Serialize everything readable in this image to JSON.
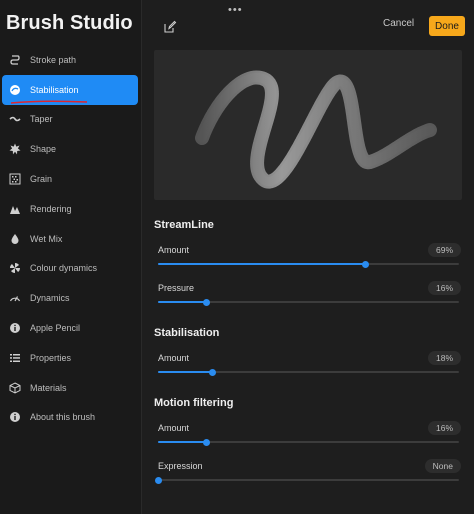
{
  "app_title": "Brush Studio",
  "sidebar": {
    "items": [
      {
        "label": "Stroke path",
        "icon": "stroke-path-icon"
      },
      {
        "label": "Stabilisation",
        "icon": "stabilisation-icon",
        "active": true
      },
      {
        "label": "Taper",
        "icon": "taper-icon"
      },
      {
        "label": "Shape",
        "icon": "shape-icon"
      },
      {
        "label": "Grain",
        "icon": "grain-icon"
      },
      {
        "label": "Rendering",
        "icon": "rendering-icon"
      },
      {
        "label": "Wet Mix",
        "icon": "wet-mix-icon"
      },
      {
        "label": "Colour dynamics",
        "icon": "colour-dynamics-icon"
      },
      {
        "label": "Dynamics",
        "icon": "dynamics-icon"
      },
      {
        "label": "Apple Pencil",
        "icon": "apple-pencil-icon"
      },
      {
        "label": "Properties",
        "icon": "properties-icon"
      },
      {
        "label": "Materials",
        "icon": "materials-icon"
      },
      {
        "label": "About this brush",
        "icon": "info-icon"
      }
    ]
  },
  "toolbar": {
    "grabber": "•••",
    "cancel_label": "Cancel",
    "done_label": "Done"
  },
  "colors": {
    "accent": "#1f8bf5",
    "done": "#f7a81b",
    "underline": "#e0262e"
  },
  "streamline": {
    "title": "StreamLine",
    "amount_label": "Amount",
    "amount_value": "69%",
    "amount": 0.69,
    "pressure_label": "Pressure",
    "pressure_value": "16%",
    "pressure": 0.16
  },
  "stabilisation": {
    "title": "Stabilisation",
    "amount_label": "Amount",
    "amount_value": "18%",
    "amount": 0.18
  },
  "motion_filtering": {
    "title": "Motion filtering",
    "amount_label": "Amount",
    "amount_value": "16%",
    "amount": 0.16,
    "expression_label": "Expression",
    "expression_value": "None",
    "expression": 0.0
  }
}
